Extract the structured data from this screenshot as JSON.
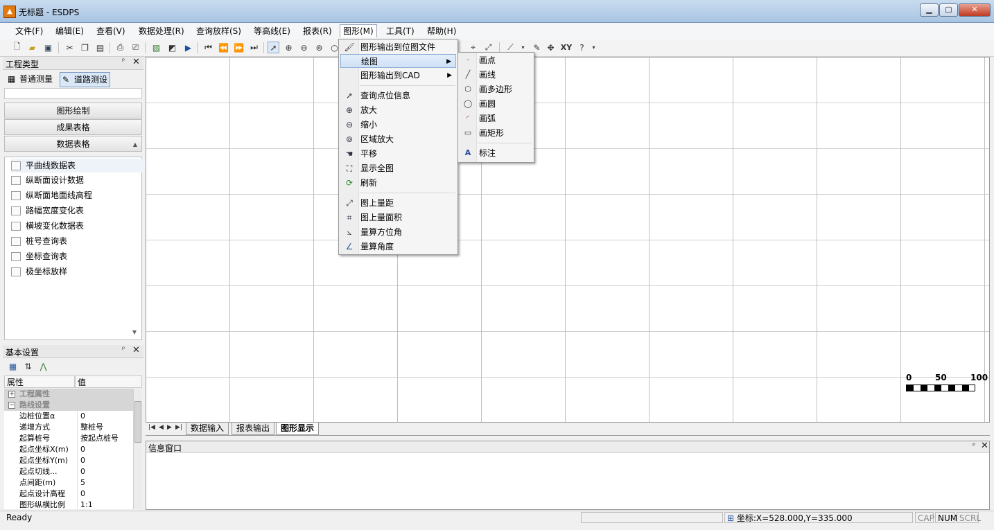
{
  "window": {
    "title": "无标题 - ESDPS",
    "app_icon": "esdps-app-icon",
    "caption_buttons": [
      "minimize",
      "maximize",
      "close"
    ]
  },
  "menubar": {
    "items": [
      "文件(F)",
      "编辑(E)",
      "查看(V)",
      "数据处理(R)",
      "查询放样(S)",
      "等高线(E)",
      "报表(R)",
      "图形(M)",
      "工具(T)",
      "帮助(H)"
    ],
    "active": "图形(M)"
  },
  "toolbar": {
    "xy_label": "XY",
    "icons": [
      "new-icon",
      "open-icon",
      "save-icon",
      "cut-icon",
      "copy-icon",
      "paste-icon",
      "print-preview-icon",
      "print-icon",
      "image-icon",
      "export-icon",
      "play-icon",
      "first-icon",
      "prev-icon",
      "next-icon",
      "last-icon",
      "select-arrow-icon",
      "zoom-in-icon",
      "zoom-out-icon",
      "zoom-region-icon",
      "zoom-icon",
      "line-tool-icon",
      "pencil-icon",
      "move-icon",
      "coordinate-icon",
      "help-icon"
    ]
  },
  "left_panel": {
    "title": "工程类型",
    "pin": "ᵖ",
    "close": "✕",
    "type_buttons": [
      "普通测量",
      "道路测设"
    ],
    "active_type": "道路测设",
    "sections": [
      "图形绘制",
      "成果表格",
      "数据表格"
    ],
    "tables": [
      "平曲线数据表",
      "纵断面设计数据",
      "纵断面地面线高程",
      "路幅宽度变化表",
      "横坡变化数据表",
      "桩号查询表",
      "坐标查询表",
      "极坐标放样"
    ],
    "selected_table": "平曲线数据表"
  },
  "basic_settings": {
    "title": "基本设置",
    "columns": [
      "属性",
      "值"
    ],
    "groups": [
      {
        "label": "工程属性",
        "toggle": "+"
      },
      {
        "label": "路线设置",
        "toggle": "−"
      }
    ],
    "rows": [
      {
        "name": "边桩位置α",
        "value": "0"
      },
      {
        "name": "递增方式",
        "value": "整桩号"
      },
      {
        "name": "起算桩号",
        "value": "按起点桩号"
      },
      {
        "name": "起点坐标X(m)",
        "value": "0"
      },
      {
        "name": "起点坐标Y(m)",
        "value": "0"
      },
      {
        "name": "起点切线...",
        "value": "0"
      },
      {
        "name": "点间距(m)",
        "value": "5"
      },
      {
        "name": "起点设计高程",
        "value": "0"
      },
      {
        "name": "图形纵横比例",
        "value": "1:1"
      }
    ]
  },
  "canvas": {
    "scale_labels": [
      "0",
      "50",
      "100"
    ],
    "tabs": [
      "数据输入",
      "报表输出",
      "图形显示"
    ],
    "active_tab": "图形显示"
  },
  "info_window": {
    "title": "信息窗口"
  },
  "statusbar": {
    "ready": "Ready",
    "coords": "坐标:X=528.000,Y=335.000",
    "indicators": [
      "CAP",
      "NUM",
      "SCRL"
    ]
  },
  "graphics_menu": {
    "items": [
      {
        "label": "图形输出到位图文件",
        "icon": "bitmap-export-icon"
      },
      {
        "label": "绘图",
        "icon": "",
        "submenu": true
      },
      {
        "label": "图形输出到CAD",
        "icon": "",
        "submenu": true
      },
      {
        "label": "查询点位信息",
        "icon": "query-point-icon"
      },
      {
        "label": "放大",
        "icon": "zoom-in-icon"
      },
      {
        "label": "缩小",
        "icon": "zoom-out-icon"
      },
      {
        "label": "区域放大",
        "icon": "zoom-region-icon"
      },
      {
        "label": "平移",
        "icon": "pan-icon"
      },
      {
        "label": "显示全图",
        "icon": "fit-all-icon"
      },
      {
        "label": "刷新",
        "icon": "refresh-icon"
      },
      {
        "label": "图上量距",
        "icon": "measure-distance-icon"
      },
      {
        "label": "图上量面积",
        "icon": "measure-area-icon"
      },
      {
        "label": "量算方位角",
        "icon": "measure-azimuth-icon"
      },
      {
        "label": "量算角度",
        "icon": "measure-angle-icon"
      }
    ],
    "highlighted": "绘图"
  },
  "draw_submenu": {
    "items": [
      {
        "label": "画点",
        "icon": "point-icon"
      },
      {
        "label": "画线",
        "icon": "line-icon"
      },
      {
        "label": "画多边形",
        "icon": "polygon-icon"
      },
      {
        "label": "画圆",
        "icon": "circle-icon"
      },
      {
        "label": "画弧",
        "icon": "arc-icon"
      },
      {
        "label": "画矩形",
        "icon": "rectangle-icon"
      },
      {
        "label": "标注",
        "icon": "annotation-icon"
      }
    ]
  }
}
